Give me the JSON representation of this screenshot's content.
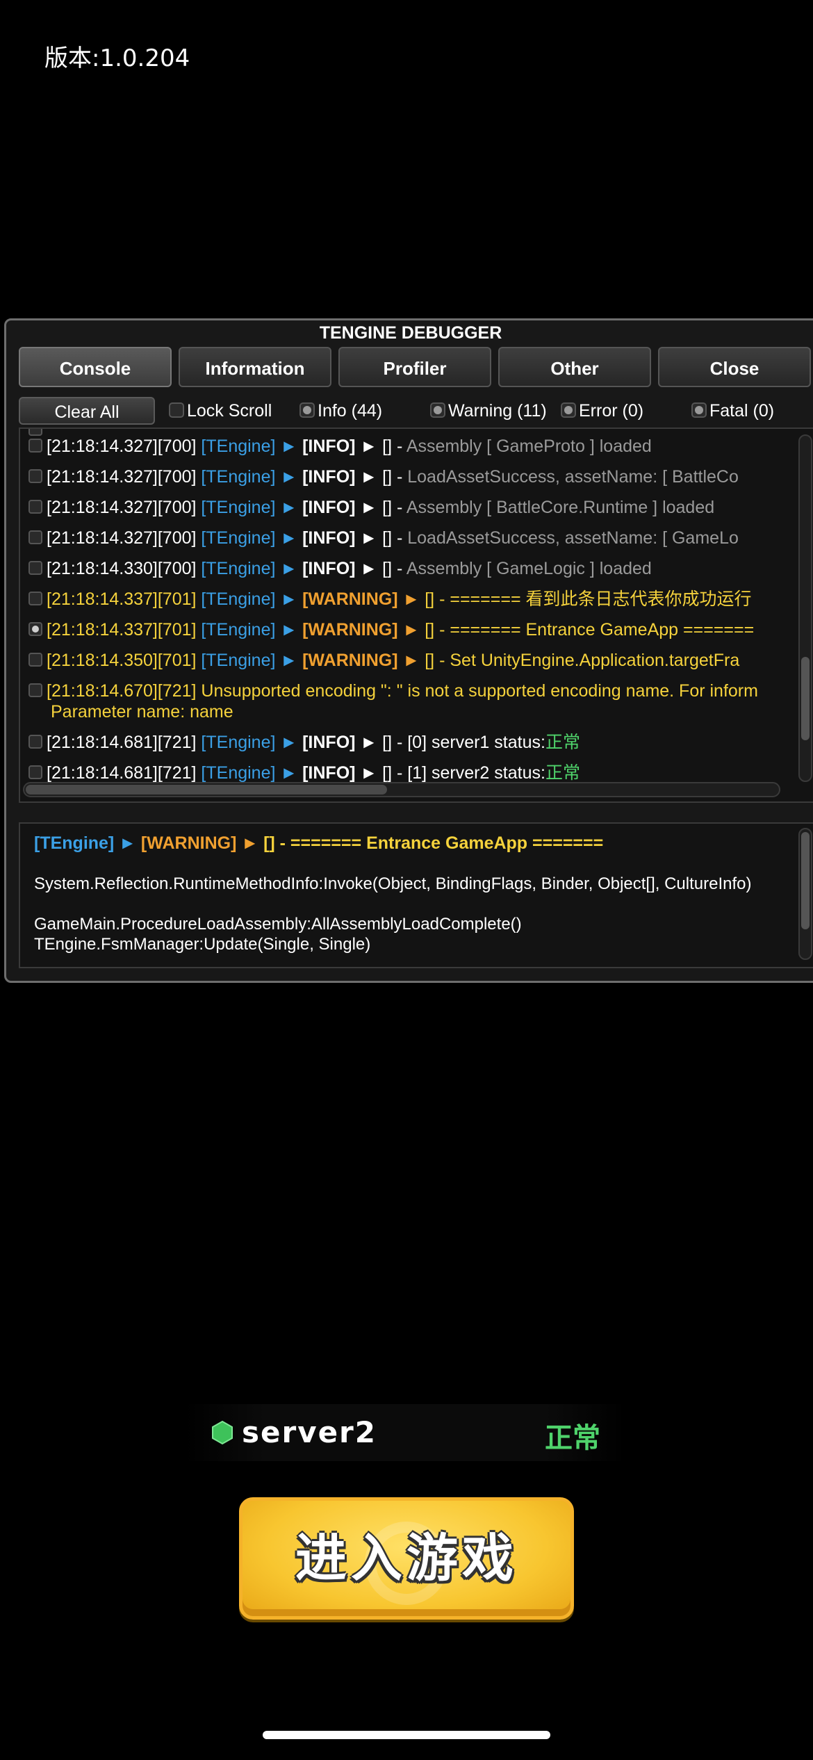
{
  "version_label": "版本:1.0.204",
  "debugger": {
    "title": "TENGINE DEBUGGER",
    "tabs": [
      {
        "label": "Console",
        "active": true
      },
      {
        "label": "Information",
        "active": false
      },
      {
        "label": "Profiler",
        "active": false
      },
      {
        "label": "Other",
        "active": false
      },
      {
        "label": "Close",
        "active": false
      }
    ],
    "filters": {
      "clear_all": "Clear All",
      "lock_scroll": "Lock Scroll",
      "info": "Info (44)",
      "warning": "Warning (11)",
      "error": "Error (0)",
      "fatal": "Fatal (0)"
    },
    "log_rows": [
      {
        "time": "[21:18:14.327][700]",
        "source": "[TEngine]",
        "arrow1": "►",
        "level": "[INFO]",
        "arrow2": "►",
        "prefix": "[] -",
        "message": "Assembly [ GameProto ] loaded"
      },
      {
        "time": "[21:18:14.327][700]",
        "source": "[TEngine]",
        "arrow1": "►",
        "level": "[INFO]",
        "arrow2": "►",
        "prefix": "[] -",
        "message": "LoadAssetSuccess, assetName: [ BattleCo"
      },
      {
        "time": "[21:18:14.327][700]",
        "source": "[TEngine]",
        "arrow1": "►",
        "level": "[INFO]",
        "arrow2": "►",
        "prefix": "[] -",
        "message": "Assembly [ BattleCore.Runtime ] loaded"
      },
      {
        "time": "[21:18:14.327][700]",
        "source": "[TEngine]",
        "arrow1": "►",
        "level": "[INFO]",
        "arrow2": "►",
        "prefix": "[] -",
        "message": "LoadAssetSuccess, assetName: [ GameLo"
      },
      {
        "time": "[21:18:14.330][700]",
        "source": "[TEngine]",
        "arrow1": "►",
        "level": "[INFO]",
        "arrow2": "►",
        "prefix": "[] -",
        "message": "Assembly [ GameLogic ] loaded"
      },
      {
        "time": "[21:18:14.337][701]",
        "source": "[TEngine]",
        "arrow1": "►",
        "level": "[WARNING]",
        "arrow2": "►",
        "prefix": "[] -",
        "message": "======= 看到此条日志代表你成功运行"
      },
      {
        "time": "[21:18:14.337][701]",
        "source": "[TEngine]",
        "arrow1": "►",
        "level": "[WARNING]",
        "arrow2": "►",
        "prefix": "[] -",
        "message": "======= Entrance GameApp ======="
      },
      {
        "time": "[21:18:14.350][701]",
        "source": "[TEngine]",
        "arrow1": "►",
        "level": "[WARNING]",
        "arrow2": "►",
        "prefix": "[] -",
        "message": "Set UnityEngine.Application.targetFra"
      }
    ],
    "error_row": {
      "line1": "[21:18:14.670][721] Unsupported encoding \": \" is not a supported encoding name. For inform",
      "line2": "Parameter name: name"
    },
    "status_rows": [
      {
        "time": "[21:18:14.681][721]",
        "source": "[TEngine]",
        "arrow1": "►",
        "level": "[INFO]",
        "arrow2": "►",
        "prefix": "[] - [0] server1 status:",
        "status": "正常"
      },
      {
        "time": "[21:18:14.681][721]",
        "source": "[TEngine]",
        "arrow1": "►",
        "level": "[INFO]",
        "arrow2": "►",
        "prefix": "[] - [1] server2 status:",
        "status": "正常"
      }
    ],
    "detail": {
      "source": "[TEngine]",
      "arrow1": "►",
      "level": "[WARNING]",
      "arrow2": "►",
      "message": "[] - ======= Entrance GameApp =======",
      "stack": [
        "System.Reflection.RuntimeMethodInfo:Invoke(Object, BindingFlags, Binder, Object[], CultureInfo)",
        "GameMain.ProcedureLoadAssembly:AllAssemblyLoadComplete()",
        "TEngine.FsmManager:Update(Single, Single)"
      ]
    }
  },
  "server": {
    "name": "server2",
    "status": "正常",
    "status_color": "#4fd36b"
  },
  "enter_button": {
    "label": "进入游戏"
  },
  "colors": {
    "tengine_blue": "#3ba0e6",
    "warning_orange": "#f0a030",
    "warning_yellow": "#f5d23c",
    "button_yellow": "#f8c630"
  }
}
